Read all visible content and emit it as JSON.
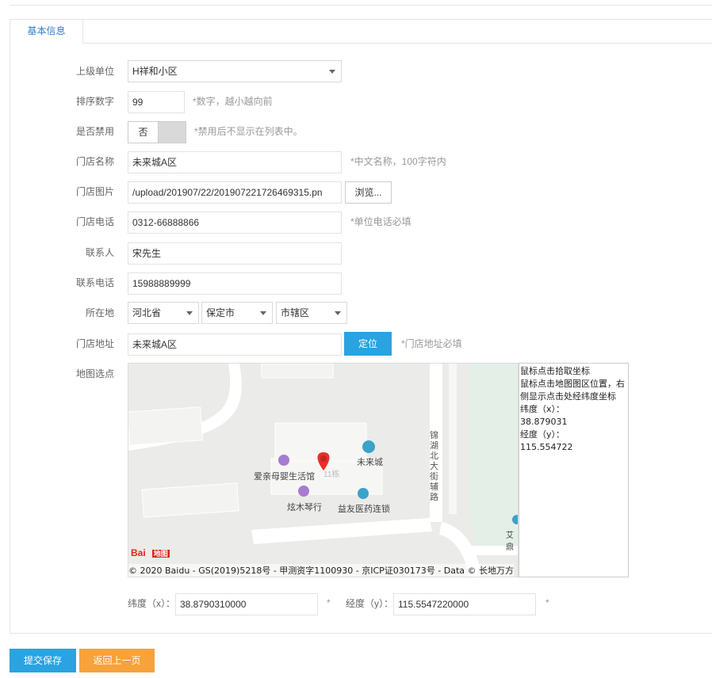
{
  "tab": {
    "label": "基本信息"
  },
  "form": {
    "parent_unit": {
      "label": "上级单位",
      "value": "H祥和小区"
    },
    "sort_number": {
      "label": "排序数字",
      "value": "99",
      "hint": "*数字，越小越向前"
    },
    "disabled": {
      "label": "是否禁用",
      "value": "否",
      "hint": "*禁用后不显示在列表中。"
    },
    "store_name": {
      "label": "门店名称",
      "value": "未来城A区",
      "hint": "*中文名称，100字符内"
    },
    "store_image": {
      "label": "门店图片",
      "value": "/upload/201907/22/201907221726469315.pn",
      "browse": "浏览..."
    },
    "store_phone": {
      "label": "门店电话",
      "value": "0312-66888866",
      "hint": "*单位电话必填"
    },
    "contact": {
      "label": "联系人",
      "value": "宋先生"
    },
    "contact_phone": {
      "label": "联系电话",
      "value": "15988889999"
    },
    "location": {
      "label": "所在地",
      "province": "河北省",
      "city": "保定市",
      "district": "市辖区"
    },
    "address": {
      "label": "门店地址",
      "value": "未来城A区",
      "locate": "定位",
      "hint": "*门店地址必填"
    },
    "map": {
      "label": "地图选点"
    },
    "lat": {
      "label": "纬度（x）：",
      "value": "38.8790310000",
      "star": "*"
    },
    "lng": {
      "label": "经度（y）：",
      "value": "115.5547220000",
      "star": "*"
    }
  },
  "map": {
    "poi_1": "爱亲母婴生活馆",
    "poi_2": "未来城",
    "poi_3": "炫木琴行",
    "poi_4": "益友医药连锁",
    "poi_5": "11栋",
    "road": "锦湖北大街辅路",
    "edge_label": "艾鼎",
    "copyright": "© 2020 Baidu - GS(2019)5218号 - 甲测资字1100930 - 京ICP证030173号 - Data © 长地万方",
    "logo_text": "Bai",
    "logo_sub": "地图"
  },
  "info_panel": {
    "line1": "鼠标点击拾取坐标",
    "line2": "鼠标点击地图图区位置，右侧显示点击处经纬度坐标",
    "lat_label": "纬度（x）：",
    "lat_value": "38.879031",
    "lng_label": "经度（y）：",
    "lng_value": "115.554722"
  },
  "buttons": {
    "save": "提交保存",
    "back": "返回上一页"
  },
  "colors": {
    "primary": "#2aa3e0",
    "back": "#f7a23b",
    "tab_text": "#2f7fc9"
  }
}
